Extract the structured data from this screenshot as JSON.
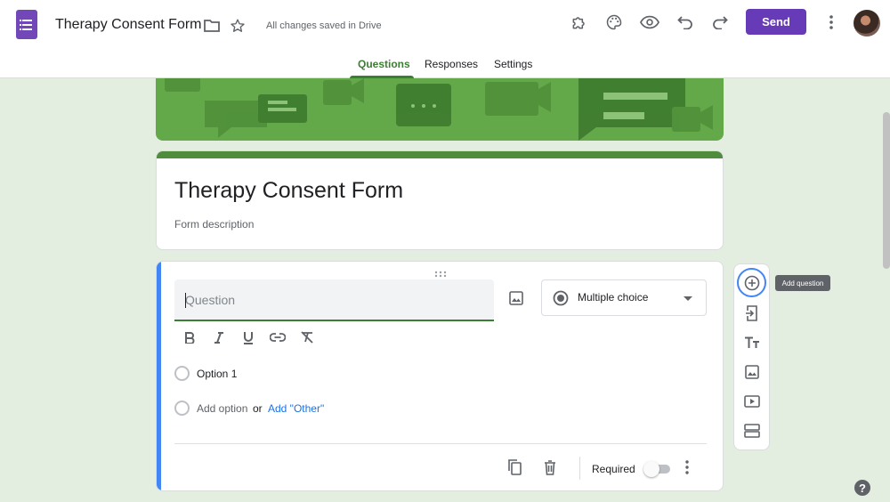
{
  "header": {
    "doc_title": "Therapy Consent Form",
    "saved_status": "All changes saved in Drive",
    "send_label": "Send",
    "icons": [
      "forms-logo-icon",
      "folder-icon",
      "star-icon",
      "addons-icon",
      "palette-icon",
      "preview-icon",
      "undo-icon",
      "redo-icon",
      "more-vert-icon"
    ]
  },
  "tabs": [
    {
      "label": "Questions",
      "active": true
    },
    {
      "label": "Responses",
      "active": false
    },
    {
      "label": "Settings",
      "active": false
    }
  ],
  "form": {
    "title": "Therapy Consent Form",
    "description_placeholder": "Form description"
  },
  "question": {
    "placeholder": "Question",
    "value": "",
    "type": "Multiple choice",
    "options": [
      "Option 1"
    ],
    "add_option": "Add option",
    "or_text": "or",
    "add_other": "Add \"Other\"",
    "required_label": "Required",
    "required": false
  },
  "float_toolbar": {
    "tooltip": "Add question",
    "items": [
      "add-question-icon",
      "import-questions-icon",
      "add-title-icon",
      "add-image-icon",
      "add-video-icon",
      "add-section-icon"
    ]
  },
  "colors": {
    "brand_purple": "#673ab7",
    "theme_green": "#3c7e33",
    "banner_green": "#63a94a",
    "active_blue": "#4285f4",
    "background": "#e3eee0"
  }
}
